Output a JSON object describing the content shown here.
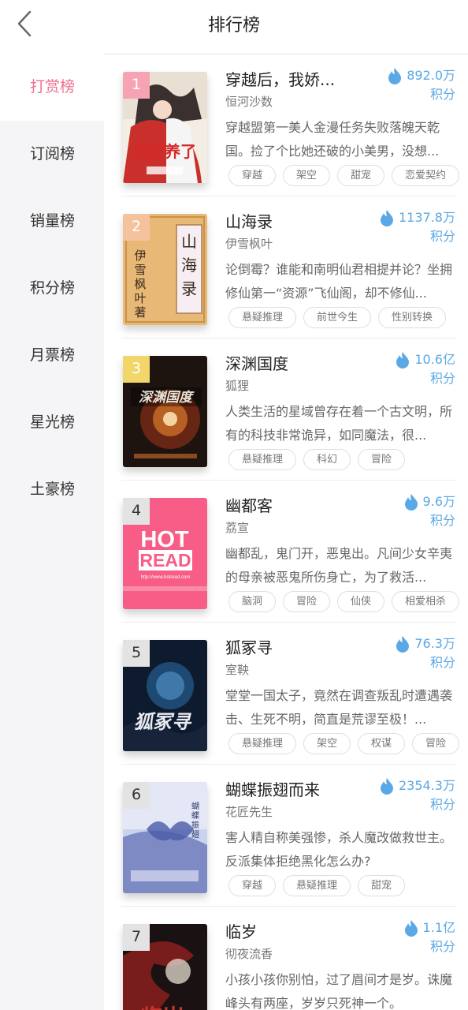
{
  "header": {
    "title": "排行榜",
    "back_icon": "chevron-left-icon"
  },
  "sidebar": {
    "items": [
      {
        "label": "打赏榜",
        "active": true
      },
      {
        "label": "订阅榜",
        "active": false
      },
      {
        "label": "销量榜",
        "active": false
      },
      {
        "label": "积分榜",
        "active": false
      },
      {
        "label": "月票榜",
        "active": false
      },
      {
        "label": "星光榜",
        "active": false
      },
      {
        "label": "土豪榜",
        "active": false
      }
    ]
  },
  "colors": {
    "accent": "#f06e8e",
    "score_blue": "#5aa8e6"
  },
  "books": [
    {
      "rank": "1",
      "title": "穿越后，我娇...",
      "author": "恒河沙数",
      "score": "892.0万",
      "unit": "积分",
      "desc": "穿越盟第一美人金漫任务失败落魄天乾国。捡了个比她还破的小美男，没想...",
      "tags": [
        "穿越",
        "架空",
        "甜宠",
        "恋爱契约"
      ],
      "cover_text": "我娇养了"
    },
    {
      "rank": "2",
      "title": "山海录",
      "author": "伊雪枫叶",
      "score": "1137.8万",
      "unit": "积分",
      "desc": "论倒霉？谁能和南明仙君相提并论？坐拥修仙第一“资源”飞仙阁，却不修仙...",
      "tags": [
        "悬疑推理",
        "前世今生",
        "性别转换"
      ],
      "cover_text": "山海录",
      "cover_author": "伊雪枫叶著"
    },
    {
      "rank": "3",
      "title": "深渊国度",
      "author": "狐狸",
      "score": "10.6亿",
      "unit": "积分",
      "desc": "人类生活的星域曾存在着一个古文明，所有的科技非常诡异，如同魔法，很...",
      "tags": [
        "悬疑推理",
        "科幻",
        "冒险"
      ],
      "cover_text": "深渊国度"
    },
    {
      "rank": "4",
      "title": "幽都客",
      "author": "荔宣",
      "score": "9.6万",
      "unit": "积分",
      "desc": "幽都乱，鬼门开，恶鬼出。凡间少女辛夷的母亲被恶鬼所伤身亡，为了救活...",
      "tags": [
        "脑洞",
        "冒险",
        "仙侠",
        "相爱相杀"
      ],
      "cover_text": "HOT READ",
      "cover_url": "http://www.hotread.com"
    },
    {
      "rank": "5",
      "title": "狐冢寻",
      "author": "室鞅",
      "score": "76.3万",
      "unit": "积分",
      "desc": "堂堂一国太子，竟然在调查叛乱时遭遇袭击、生死不明，简直是荒谬至极！...",
      "tags": [
        "悬疑推理",
        "架空",
        "权谋",
        "冒险"
      ],
      "cover_text": "狐冢寻"
    },
    {
      "rank": "6",
      "title": "蝴蝶振翅而来",
      "author": "花匠先生",
      "score": "2354.3万",
      "unit": "积分",
      "desc": "害人精自称美强惨，杀人魔改做救世主。反派集体拒绝黑化怎么办?",
      "tags": [
        "穿越",
        "悬疑推理",
        "甜宠"
      ],
      "cover_text": "蝴蝶振翅而来"
    },
    {
      "rank": "7",
      "title": "临岁",
      "author": "彻夜流香",
      "score": "1.1亿",
      "unit": "积分",
      "desc": "小孩小孩你别怕，过了眉间才是岁。诛魔峰头有两座，岁岁只死神一个。",
      "tags": [],
      "cover_text": "临岁"
    }
  ]
}
